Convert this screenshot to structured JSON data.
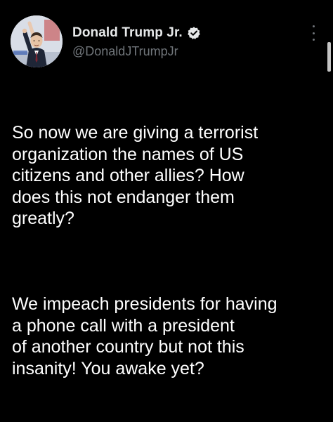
{
  "tweet": {
    "author": {
      "display_name": "Donald Trump Jr.",
      "handle": "@DonaldJTrumpJr",
      "verified": true,
      "avatar_icon": "profile-photo"
    },
    "more_icon": "more-vertical-icon",
    "body_paragraphs": [
      "So now we are giving a terrorist\norganization the names of US\ncitizens and other allies? How\ndoes this not endanger them\ngreatly?",
      "We impeach presidents for having\na phone call with a president\nof another country but not this\ninsanity! You awake yet?"
    ]
  },
  "colors": {
    "background": "#000000",
    "text_primary": "#ffffff",
    "text_secondary": "#71767b",
    "verified_badge": "#e7e9ea"
  }
}
